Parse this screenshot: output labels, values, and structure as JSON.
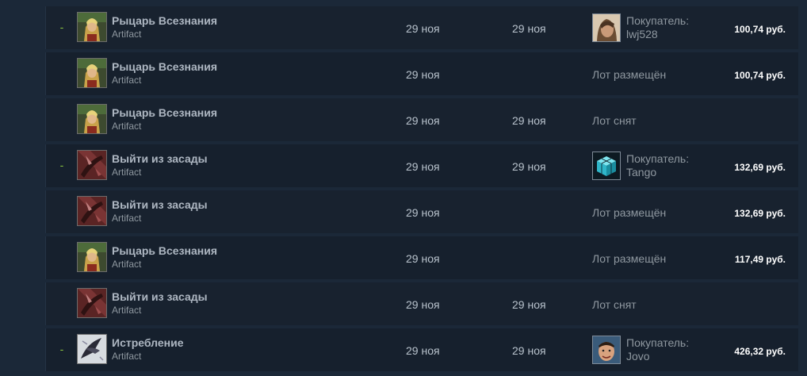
{
  "history": [
    {
      "gain": "-",
      "item": "Рыцарь Всезнания",
      "game": "Artifact",
      "icon": "knight-hero-icon",
      "listed": "29 ноя",
      "acted": "29 ноя",
      "status": "",
      "buyer_label": "Покупатель:",
      "buyer_name": "lwj528",
      "buyer_avatar": "buyer-avatar-portrait",
      "price": "100,74 руб."
    },
    {
      "gain": "",
      "item": "Рыцарь Всезнания",
      "game": "Artifact",
      "icon": "knight-hero-icon",
      "listed": "29 ноя",
      "acted": "",
      "status": "Лот размещён",
      "buyer_label": "",
      "buyer_name": "",
      "buyer_avatar": "",
      "price": "100,74 руб."
    },
    {
      "gain": "",
      "item": "Рыцарь Всезнания",
      "game": "Artifact",
      "icon": "knight-hero-icon",
      "listed": "29 ноя",
      "acted": "29 ноя",
      "status": "Лот снят",
      "buyer_label": "",
      "buyer_name": "",
      "buyer_avatar": "",
      "price": ""
    },
    {
      "gain": "-",
      "item": "Выйти из засады",
      "game": "Artifact",
      "icon": "ambush-card-icon",
      "listed": "29 ноя",
      "acted": "29 ноя",
      "status": "",
      "buyer_label": "Покупатель:",
      "buyer_name": "Tango",
      "buyer_avatar": "buyer-avatar-cube",
      "price": "132,69 руб."
    },
    {
      "gain": "",
      "item": "Выйти из засады",
      "game": "Artifact",
      "icon": "ambush-card-icon",
      "listed": "29 ноя",
      "acted": "",
      "status": "Лот размещён",
      "buyer_label": "",
      "buyer_name": "",
      "buyer_avatar": "",
      "price": "132,69 руб."
    },
    {
      "gain": "",
      "item": "Рыцарь Всезнания",
      "game": "Artifact",
      "icon": "knight-hero-icon",
      "listed": "29 ноя",
      "acted": "",
      "status": "Лот размещён",
      "buyer_label": "",
      "buyer_name": "",
      "buyer_avatar": "",
      "price": "117,49 руб."
    },
    {
      "gain": "",
      "item": "Выйти из засады",
      "game": "Artifact",
      "icon": "ambush-card-icon",
      "listed": "29 ноя",
      "acted": "29 ноя",
      "status": "Лот снят",
      "buyer_label": "",
      "buyer_name": "",
      "buyer_avatar": "",
      "price": ""
    },
    {
      "gain": "-",
      "item": "Истребление",
      "game": "Artifact",
      "icon": "annihilation-card-icon",
      "listed": "29 ноя",
      "acted": "29 ноя",
      "status": "",
      "buyer_label": "Покупатель:",
      "buyer_name": "Jovo",
      "buyer_avatar": "buyer-avatar-face",
      "price": "426,32 руб."
    }
  ]
}
